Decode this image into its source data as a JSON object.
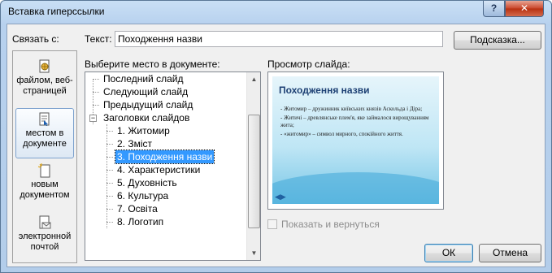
{
  "window": {
    "title": "Вставка гиперссылки",
    "help_glyph": "?",
    "close_glyph": "✕"
  },
  "link_with": {
    "label": "Связать с:",
    "places": [
      {
        "label": "файлом, веб-страницей",
        "icon": "file-web-page-icon",
        "selected": false
      },
      {
        "label": "местом в документе",
        "icon": "place-in-document-icon",
        "selected": true
      },
      {
        "label": "новым документом",
        "icon": "new-document-icon",
        "selected": false
      },
      {
        "label": "электронной почтой",
        "icon": "email-icon",
        "selected": false
      }
    ]
  },
  "text_field": {
    "label": "Текст:",
    "value": "Походження назви"
  },
  "hint_button": "Подсказка...",
  "document_tree": {
    "label": "Выберите место в документе:",
    "items": [
      {
        "text": "Последний слайд",
        "level": 1
      },
      {
        "text": "Следующий слайд",
        "level": 1
      },
      {
        "text": "Предыдущий слайд",
        "level": 1
      },
      {
        "text": "Заголовки слайдов",
        "level": 1,
        "expander": "−"
      },
      {
        "text": "1. Житомир",
        "level": 2
      },
      {
        "text": "2. Зміст",
        "level": 2
      },
      {
        "text": "3. Походження назви",
        "level": 2,
        "selected": true
      },
      {
        "text": "4. Характеристики",
        "level": 2
      },
      {
        "text": "5. Духовність",
        "level": 2
      },
      {
        "text": "6. Культура",
        "level": 2
      },
      {
        "text": "7. Освіта",
        "level": 2
      },
      {
        "text": "8. Логотип",
        "level": 2
      }
    ]
  },
  "preview": {
    "label": "Просмотр слайда:",
    "slide_title": "Походження назви",
    "slide_lines": [
      "- Житомир – дружинник київських князів Аскольда і Діра;",
      "- Житичі – древлянське плем'я, яке займалося вирощуванням жита;",
      "- «житомир» – символ мирного, спокійного життя."
    ]
  },
  "show_and_return": {
    "label": "Показать и вернуться",
    "checked": false,
    "enabled": false
  },
  "ok_button": "ОК",
  "cancel_button": "Отмена"
}
